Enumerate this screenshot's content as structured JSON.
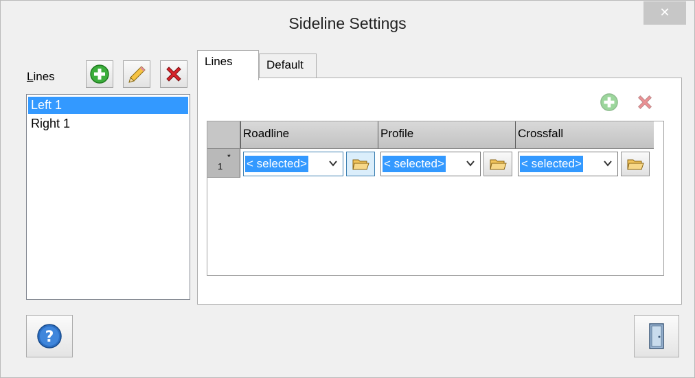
{
  "window": {
    "title": "Sideline Settings",
    "close_glyph": "✕"
  },
  "lines_panel": {
    "label_mnemonic": "L",
    "label_rest": "ines",
    "toolbar": {
      "add_icon": "add-green-plus-icon",
      "edit_icon": "pencil-icon",
      "delete_icon": "red-x-icon"
    },
    "items": [
      {
        "label": "Left 1",
        "selected": true
      },
      {
        "label": "Right 1",
        "selected": false
      }
    ]
  },
  "tabs": [
    {
      "label": "Lines",
      "active": true
    },
    {
      "label": "Default",
      "active": false
    }
  ],
  "grid": {
    "columns": [
      "Roadline",
      "Profile",
      "Crossfall"
    ],
    "rows": [
      {
        "number": "1",
        "marker": "*",
        "cells": [
          {
            "value": "< selected>"
          },
          {
            "value": "< selected>"
          },
          {
            "value": "< selected>"
          }
        ]
      }
    ]
  },
  "colors": {
    "selection": "#3399ff",
    "add_green": "#3cae3c",
    "delete_red": "#d8232a"
  }
}
